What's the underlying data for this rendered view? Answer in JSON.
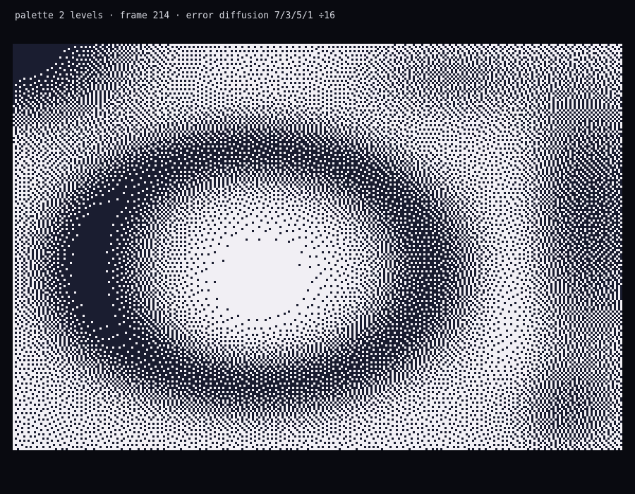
{
  "status": {
    "text": "palette 2 levels · frame 214 · error diffusion 7/3/5/1 ÷16"
  },
  "render": {
    "palette_levels": 2,
    "frame": 214,
    "diffusion_weights": [
      7,
      3,
      5,
      1
    ],
    "diffusion_divisor": 16,
    "palette_colors": {
      "dark": "#1a1d30",
      "light": "#f1eff4",
      "background": "#090a10"
    }
  }
}
